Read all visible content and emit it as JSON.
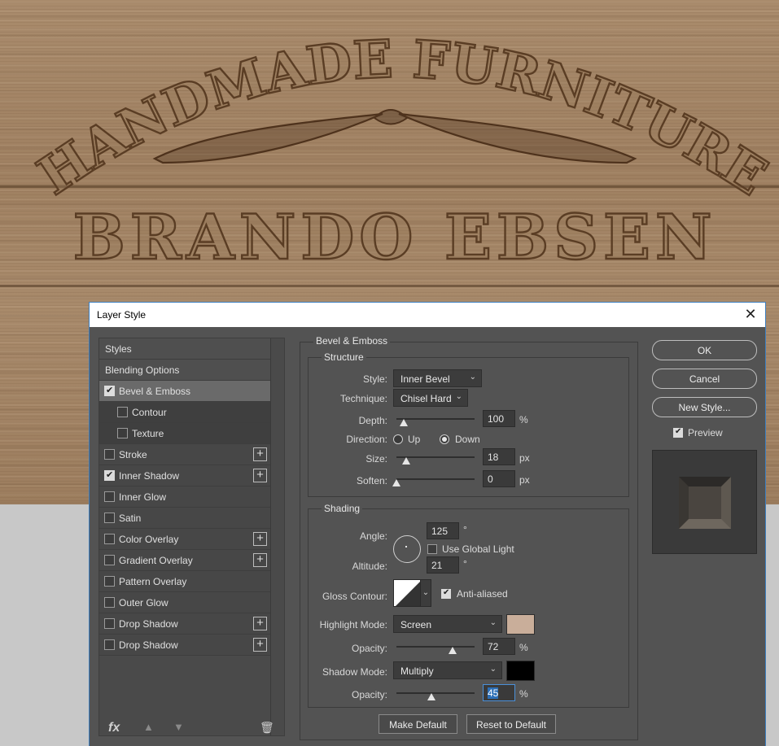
{
  "artwork": {
    "arc_text": "HANDMADE FURNITURE",
    "main_text": "BRANDO EBSEN"
  },
  "dialog": {
    "title": "Layer Style",
    "close_glyph": "✕"
  },
  "sidebar": {
    "items": [
      {
        "label": "Styles",
        "checkbox": false,
        "checked": false,
        "plus": false,
        "kind": "head"
      },
      {
        "label": "Blending Options",
        "checkbox": false,
        "checked": false,
        "plus": false,
        "kind": "head"
      },
      {
        "label": "Bevel & Emboss",
        "checkbox": true,
        "checked": true,
        "plus": false,
        "kind": "sel"
      },
      {
        "label": "Contour",
        "checkbox": true,
        "checked": false,
        "plus": false,
        "kind": "sub"
      },
      {
        "label": "Texture",
        "checkbox": true,
        "checked": false,
        "plus": false,
        "kind": "sub"
      },
      {
        "label": "Stroke",
        "checkbox": true,
        "checked": false,
        "plus": true,
        "kind": "item"
      },
      {
        "label": "Inner Shadow",
        "checkbox": true,
        "checked": true,
        "plus": true,
        "kind": "item"
      },
      {
        "label": "Inner Glow",
        "checkbox": true,
        "checked": false,
        "plus": false,
        "kind": "item"
      },
      {
        "label": "Satin",
        "checkbox": true,
        "checked": false,
        "plus": false,
        "kind": "item"
      },
      {
        "label": "Color Overlay",
        "checkbox": true,
        "checked": false,
        "plus": true,
        "kind": "item"
      },
      {
        "label": "Gradient Overlay",
        "checkbox": true,
        "checked": false,
        "plus": true,
        "kind": "item"
      },
      {
        "label": "Pattern Overlay",
        "checkbox": true,
        "checked": false,
        "plus": false,
        "kind": "item"
      },
      {
        "label": "Outer Glow",
        "checkbox": true,
        "checked": false,
        "plus": false,
        "kind": "item"
      },
      {
        "label": "Drop Shadow",
        "checkbox": true,
        "checked": false,
        "plus": true,
        "kind": "item"
      },
      {
        "label": "Drop Shadow",
        "checkbox": true,
        "checked": false,
        "plus": true,
        "kind": "item"
      }
    ],
    "fx_label": "fx",
    "up_icon": "▲",
    "down_icon": "▼",
    "trash_icon": "🗑"
  },
  "bevel": {
    "section_title": "Bevel & Emboss",
    "structure_title": "Structure",
    "style_label": "Style:",
    "style_value": "Inner Bevel",
    "technique_label": "Technique:",
    "technique_value": "Chisel Hard",
    "depth_label": "Depth:",
    "depth_value": "100",
    "depth_unit": "%",
    "direction_label": "Direction:",
    "direction_up": "Up",
    "direction_down": "Down",
    "size_label": "Size:",
    "size_value": "18",
    "size_unit": "px",
    "soften_label": "Soften:",
    "soften_value": "0",
    "soften_unit": "px"
  },
  "shading": {
    "title": "Shading",
    "angle_label": "Angle:",
    "angle_value": "125",
    "degree": "°",
    "global_light_label": "Use Global Light",
    "altitude_label": "Altitude:",
    "altitude_value": "21",
    "gloss_label": "Gloss Contour:",
    "anti_aliased_label": "Anti-aliased",
    "highlight_mode_label": "Highlight Mode:",
    "highlight_mode_value": "Screen",
    "highlight_color": "#c9ae9a",
    "opacity_label": "Opacity:",
    "highlight_opacity": "72",
    "percent": "%",
    "shadow_mode_label": "Shadow Mode:",
    "shadow_mode_value": "Multiply",
    "shadow_color": "#000000",
    "shadow_opacity_label": "Opacity:",
    "shadow_opacity": "45"
  },
  "buttons": {
    "make_default": "Make Default",
    "reset_default": "Reset to Default",
    "ok": "OK",
    "cancel": "Cancel",
    "new_style": "New Style...",
    "preview_label": "Preview"
  }
}
